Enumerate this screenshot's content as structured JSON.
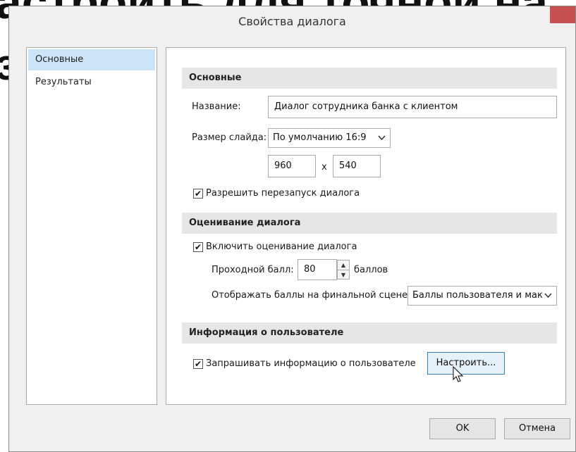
{
  "background_text": {
    "line1": "астроить для точной на",
    "line2": "з"
  },
  "window": {
    "title": "Свойства диалога",
    "close_glyph": "×"
  },
  "sidebar": {
    "items": [
      {
        "label": "Основные",
        "selected": true
      },
      {
        "label": "Результаты",
        "selected": false
      }
    ]
  },
  "basic": {
    "header": "Основные",
    "name_label": "Название:",
    "name_value": "Диалог сотрудника банка с клиентом",
    "slide_size_label": "Размер слайда:",
    "slide_size_value": "По умолчанию 16:9",
    "width_value": "960",
    "x_separator": "x",
    "height_value": "540",
    "allow_restart_label": "Разрешить перезапуск диалога",
    "allow_restart_checked": true
  },
  "scoring": {
    "header": "Оценивание диалога",
    "enable_label": "Включить оценивание диалога",
    "enable_checked": true,
    "passing_label": "Проходной балл:",
    "passing_value": "80",
    "points_unit": "баллов",
    "display_label": "Отображать баллы на финальной сцене:",
    "display_value": "Баллы пользователя и мак"
  },
  "user_info": {
    "header": "Информация о пользователе",
    "ask_label": "Запрашивать информацию о пользователе",
    "ask_checked": true,
    "configure_button": "Настроить..."
  },
  "footer": {
    "ok_button": "OK",
    "cancel_button": "Отмена"
  },
  "icons": {
    "check": "✔",
    "chevron": "⌄",
    "spin_up": "▲",
    "spin_down": "▼"
  }
}
